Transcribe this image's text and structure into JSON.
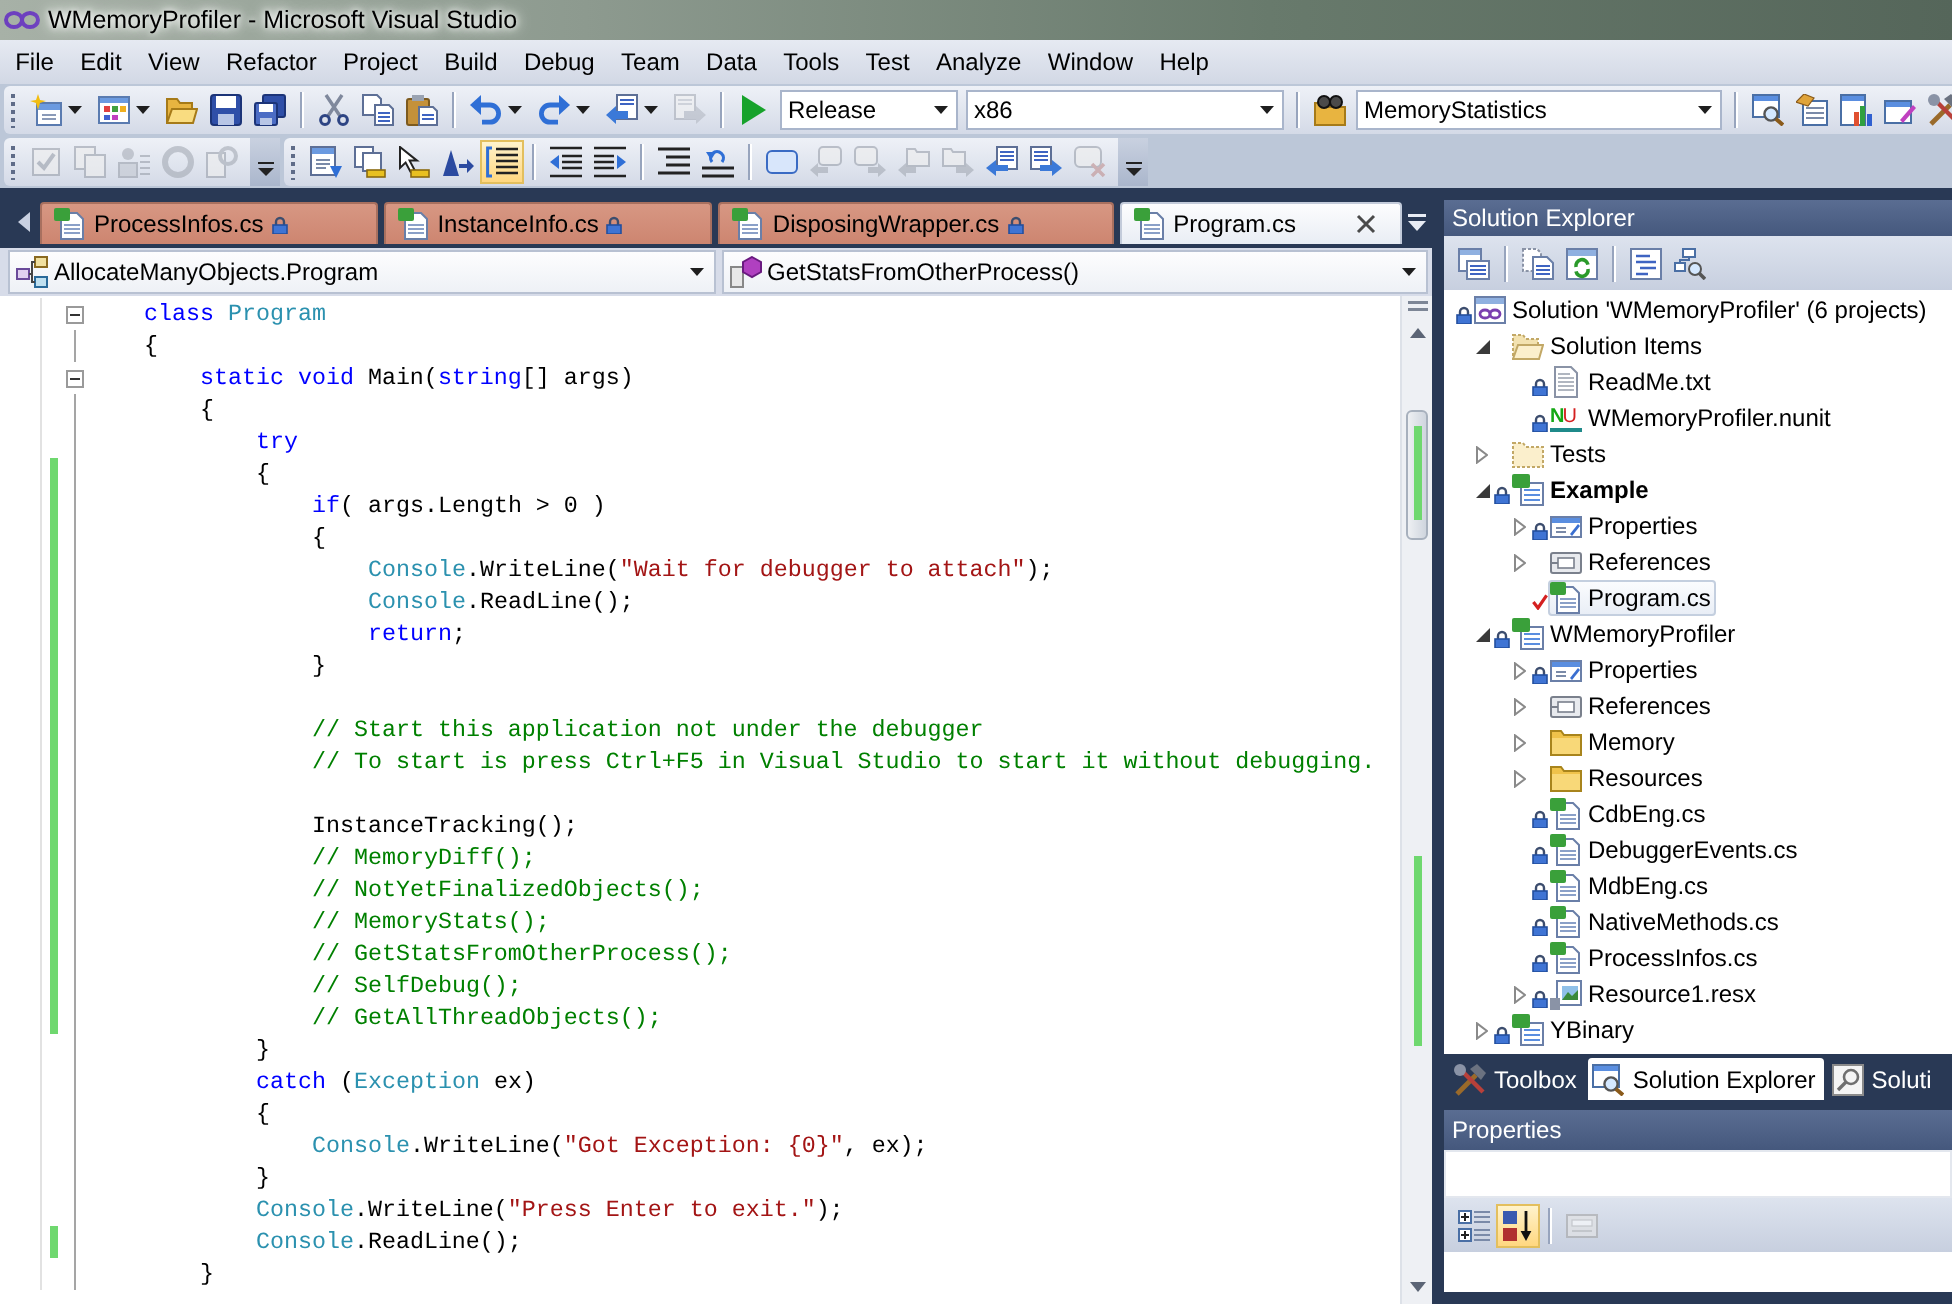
{
  "window": {
    "title": "WMemoryProfiler - Microsoft Visual Studio"
  },
  "menu": [
    "File",
    "Edit",
    "View",
    "Refactor",
    "Project",
    "Build",
    "Debug",
    "Team",
    "Data",
    "Tools",
    "Test",
    "Analyze",
    "Window",
    "Help"
  ],
  "standard_toolbar": [
    {
      "kind": "button",
      "menu": true,
      "disabled": false
    },
    {
      "kind": "button",
      "menu": true,
      "disabled": false
    },
    {
      "kind": "button",
      "disabled": false
    },
    {
      "kind": "button",
      "disabled": false
    },
    {
      "kind": "button",
      "disabled": false
    },
    {
      "kind": "separator"
    },
    {
      "kind": "button",
      "disabled": false
    },
    {
      "kind": "button",
      "disabled": false
    },
    {
      "kind": "button",
      "disabled": false
    },
    {
      "kind": "separator"
    },
    {
      "kind": "button",
      "menu": true,
      "disabled": false
    },
    {
      "kind": "button",
      "menu": true,
      "disabled": false
    },
    {
      "kind": "button",
      "menu": true,
      "disabled": false
    },
    {
      "kind": "button",
      "disabled": true
    },
    {
      "kind": "separator"
    },
    {
      "kind": "button",
      "disabled": false
    },
    {
      "kind": "combo",
      "value": "Release"
    },
    {
      "kind": "combo",
      "value": "x86"
    },
    {
      "kind": "separator"
    },
    {
      "kind": "button",
      "disabled": false
    },
    {
      "kind": "combo",
      "value": "MemoryStatistics"
    },
    {
      "kind": "separator"
    },
    {
      "kind": "button",
      "disabled": false
    },
    {
      "kind": "button",
      "disabled": false
    },
    {
      "kind": "button",
      "disabled": false
    },
    {
      "kind": "button",
      "disabled": false
    },
    {
      "kind": "button",
      "disabled": false
    }
  ],
  "second_toolbars": [
    [
      {
        "kind": "button",
        "disabled": true
      },
      {
        "kind": "button",
        "disabled": true
      },
      {
        "kind": "button",
        "disabled": true
      },
      {
        "kind": "button",
        "disabled": true
      },
      {
        "kind": "button",
        "disabled": true
      },
      {
        "kind": "overflow"
      }
    ],
    [
      {
        "kind": "button",
        "disabled": false
      },
      {
        "kind": "button",
        "disabled": false
      },
      {
        "kind": "button",
        "disabled": false
      },
      {
        "kind": "button",
        "disabled": false
      },
      {
        "kind": "button",
        "checked": true,
        "disabled": false
      },
      {
        "kind": "separator"
      },
      {
        "kind": "button",
        "disabled": false
      },
      {
        "kind": "button",
        "disabled": false
      },
      {
        "kind": "separator"
      },
      {
        "kind": "button",
        "disabled": false
      },
      {
        "kind": "button",
        "disabled": false
      },
      {
        "kind": "separator"
      },
      {
        "kind": "button",
        "disabled": false
      },
      {
        "kind": "button",
        "disabled": true
      },
      {
        "kind": "button",
        "disabled": true
      },
      {
        "kind": "button",
        "disabled": true
      },
      {
        "kind": "button",
        "disabled": true
      },
      {
        "kind": "button",
        "disabled": false
      },
      {
        "kind": "button",
        "disabled": false
      },
      {
        "kind": "button",
        "disabled": true
      },
      {
        "kind": "overflow"
      }
    ]
  ],
  "editor": {
    "tabs": [
      {
        "label": "ProcessInfos.cs",
        "selected": false,
        "read_only": true
      },
      {
        "label": "InstanceInfo.cs",
        "selected": false,
        "read_only": true
      },
      {
        "label": "DisposingWrapper.cs",
        "selected": false,
        "read_only": true
      },
      {
        "label": "Program.cs",
        "selected": true,
        "read_only": false
      }
    ],
    "type_selector": "AllocateManyObjects.Program",
    "member_selector": "GetStatsFromOtherProcess()",
    "lines": [
      {
        "changed": false,
        "expanded": true,
        "tokens": [
          {
            "kind": "keyword",
            "text": "class"
          },
          {
            "kind": "type",
            "text": " Program"
          }
        ]
      },
      {
        "changed": false,
        "tokens": [
          {
            "kind": "plain",
            "text": "{"
          }
        ],
        "children": [
          {
            "changed": false,
            "expanded": true,
            "tokens": [
              {
                "kind": "keyword",
                "text": "static void"
              },
              {
                "kind": "plain",
                "text": " Main("
              },
              {
                "kind": "keyword",
                "text": "string"
              },
              {
                "kind": "plain",
                "text": "[] args)"
              }
            ]
          },
          {
            "changed": false,
            "tokens": [
              {
                "kind": "plain",
                "text": "{"
              }
            ],
            "children": [
              {
                "changed": false,
                "tokens": [
                  {
                    "kind": "keyword",
                    "text": "try"
                  }
                ]
              },
              {
                "changed": true,
                "tokens": [
                  {
                    "kind": "plain",
                    "text": "{"
                  }
                ],
                "children": [
                  {
                    "changed": true,
                    "tokens": [
                      {
                        "kind": "keyword",
                        "text": "if"
                      },
                      {
                        "kind": "plain",
                        "text": "( args.Length > 0 )"
                      }
                    ]
                  },
                  {
                    "changed": true,
                    "tokens": [
                      {
                        "kind": "plain",
                        "text": "{"
                      }
                    ],
                    "children": [
                      {
                        "changed": true,
                        "tokens": [
                          {
                            "kind": "type",
                            "text": "Console"
                          },
                          {
                            "kind": "plain",
                            "text": ".WriteLine("
                          },
                          {
                            "kind": "string",
                            "text": "\"Wait for debugger to attach\""
                          },
                          {
                            "kind": "plain",
                            "text": ");"
                          }
                        ]
                      },
                      {
                        "changed": true,
                        "tokens": [
                          {
                            "kind": "type",
                            "text": "Console"
                          },
                          {
                            "kind": "plain",
                            "text": ".ReadLine();"
                          }
                        ]
                      },
                      {
                        "changed": true,
                        "tokens": [
                          {
                            "kind": "keyword",
                            "text": "return"
                          },
                          {
                            "kind": "plain",
                            "text": ";"
                          }
                        ]
                      }
                    ]
                  },
                  {
                    "changed": true,
                    "tokens": [
                      {
                        "kind": "plain",
                        "text": "}"
                      }
                    ]
                  },
                  {
                    "changed": true
                  },
                  {
                    "changed": true,
                    "tokens": [
                      {
                        "kind": "comment",
                        "text": "// Start this application not under the debugger"
                      }
                    ]
                  },
                  {
                    "changed": true,
                    "tokens": [
                      {
                        "kind": "comment",
                        "text": "// To start is press Ctrl+F5 in Visual Studio to start it without debugging."
                      }
                    ]
                  },
                  {
                    "changed": true
                  },
                  {
                    "changed": true,
                    "tokens": [
                      {
                        "kind": "plain",
                        "text": "InstanceTracking();"
                      }
                    ]
                  },
                  {
                    "changed": true,
                    "tokens": [
                      {
                        "kind": "comment",
                        "text": "// MemoryDiff();"
                      }
                    ]
                  },
                  {
                    "changed": true,
                    "tokens": [
                      {
                        "kind": "comment",
                        "text": "// NotYetFinalizedObjects();"
                      }
                    ]
                  },
                  {
                    "changed": true,
                    "tokens": [
                      {
                        "kind": "comment",
                        "text": "// MemoryStats();"
                      }
                    ]
                  },
                  {
                    "changed": true,
                    "tokens": [
                      {
                        "kind": "comment",
                        "text": "// GetStatsFromOtherProcess();"
                      }
                    ]
                  },
                  {
                    "changed": true,
                    "tokens": [
                      {
                        "kind": "comment",
                        "text": "// SelfDebug();"
                      }
                    ]
                  },
                  {
                    "changed": true,
                    "tokens": [
                      {
                        "kind": "comment",
                        "text": "// GetAllThreadObjects();"
                      }
                    ]
                  }
                ]
              },
              {
                "changed": false,
                "tokens": [
                  {
                    "kind": "plain",
                    "text": "}"
                  }
                ]
              },
              {
                "changed": false,
                "tokens": [
                  {
                    "kind": "keyword",
                    "text": "catch"
                  },
                  {
                    "kind": "plain",
                    "text": " ("
                  },
                  {
                    "kind": "type",
                    "text": "Exception"
                  },
                  {
                    "kind": "plain",
                    "text": " ex)"
                  }
                ]
              },
              {
                "changed": false,
                "tokens": [
                  {
                    "kind": "plain",
                    "text": "{"
                  }
                ],
                "children": [
                  {
                    "changed": false,
                    "tokens": [
                      {
                        "kind": "type",
                        "text": "Console"
                      },
                      {
                        "kind": "plain",
                        "text": ".WriteLine("
                      },
                      {
                        "kind": "string",
                        "text": "\"Got Exception: {0}\""
                      },
                      {
                        "kind": "plain",
                        "text": ", ex);"
                      }
                    ]
                  }
                ]
              },
              {
                "changed": false,
                "tokens": [
                  {
                    "kind": "plain",
                    "text": "}"
                  }
                ]
              },
              {
                "changed": false,
                "tokens": [
                  {
                    "kind": "type",
                    "text": "Console"
                  },
                  {
                    "kind": "plain",
                    "text": ".WriteLine("
                  },
                  {
                    "kind": "string",
                    "text": "\"Press Enter to exit.\""
                  },
                  {
                    "kind": "plain",
                    "text": ");"
                  }
                ]
              },
              {
                "changed": true,
                "tokens": [
                  {
                    "kind": "type",
                    "text": "Console"
                  },
                  {
                    "kind": "plain",
                    "text": ".ReadLine();"
                  }
                ]
              }
            ]
          },
          {
            "changed": false,
            "tokens": [
              {
                "kind": "plain",
                "text": "}"
              }
            ]
          }
        ]
      }
    ]
  },
  "solution_explorer": {
    "title": "Solution Explorer",
    "toolbar": [
      {
        "kind": "button"
      },
      {
        "kind": "separator"
      },
      {
        "kind": "button"
      },
      {
        "kind": "button"
      },
      {
        "kind": "separator"
      },
      {
        "kind": "button"
      },
      {
        "kind": "button"
      }
    ],
    "tree": {
      "label": "Solution 'WMemoryProfiler' (6 projects)",
      "kind": "solution",
      "locked": true,
      "selected": false,
      "children": [
        {
          "label": "Solution Items",
          "kind": "solution-folder",
          "expanded": true,
          "locked": false,
          "selected": false,
          "startup": false,
          "children": [
            {
              "label": "ReadMe.txt",
              "kind": "text-file",
              "locked": true,
              "selected": false
            },
            {
              "label": "WMemoryProfiler.nunit",
              "kind": "nunit",
              "icon_text": "NU",
              "locked": true,
              "selected": false
            }
          ]
        },
        {
          "label": "Tests",
          "kind": "solution-folder",
          "expanded": false,
          "locked": false,
          "selected": false,
          "startup": false
        },
        {
          "label": "Example",
          "kind": "project",
          "expanded": true,
          "locked": true,
          "selected": false,
          "startup": true,
          "children": [
            {
              "label": "Properties",
              "kind": "properties",
              "expanded": false,
              "locked": true,
              "selected": false
            },
            {
              "label": "References",
              "kind": "references",
              "expanded": false,
              "locked": false,
              "selected": false
            },
            {
              "label": "Program.cs",
              "kind": "source",
              "locked": false,
              "checked_out": true,
              "selected": true
            }
          ]
        },
        {
          "label": "WMemoryProfiler",
          "kind": "project",
          "expanded": true,
          "locked": true,
          "selected": false,
          "startup": false,
          "children": [
            {
              "label": "Properties",
              "kind": "properties",
              "expanded": false,
              "locked": true,
              "selected": false
            },
            {
              "label": "References",
              "kind": "references",
              "expanded": false,
              "locked": false,
              "selected": false
            },
            {
              "label": "Memory",
              "kind": "folder",
              "expanded": false,
              "locked": false,
              "selected": false
            },
            {
              "label": "Resources",
              "kind": "folder",
              "expanded": false,
              "locked": false,
              "selected": false
            },
            {
              "label": "CdbEng.cs",
              "kind": "source",
              "locked": true,
              "selected": false
            },
            {
              "label": "DebuggerEvents.cs",
              "kind": "source",
              "locked": true,
              "selected": false
            },
            {
              "label": "MdbEng.cs",
              "kind": "source",
              "locked": true,
              "selected": false
            },
            {
              "label": "NativeMethods.cs",
              "kind": "source",
              "locked": true,
              "selected": false
            },
            {
              "label": "ProcessInfos.cs",
              "kind": "source",
              "locked": true,
              "selected": false
            },
            {
              "label": "Resource1.resx",
              "kind": "resx",
              "expanded": false,
              "locked": true,
              "selected": false
            }
          ]
        },
        {
          "label": "YBinary",
          "kind": "project",
          "expanded": false,
          "locked": true,
          "selected": false,
          "startup": false
        }
      ]
    }
  },
  "tool_tabs": [
    {
      "label": "Toolbox",
      "selected": false
    },
    {
      "label": "Solution Explorer",
      "selected": true
    },
    {
      "label": "Soluti",
      "selected": false
    }
  ],
  "properties": {
    "title": "Properties",
    "toolbar": [
      {
        "kind": "button",
        "disabled": false
      },
      {
        "kind": "button",
        "checked": true,
        "disabled": false
      },
      {
        "kind": "separator"
      },
      {
        "kind": "button",
        "disabled": true
      }
    ]
  }
}
